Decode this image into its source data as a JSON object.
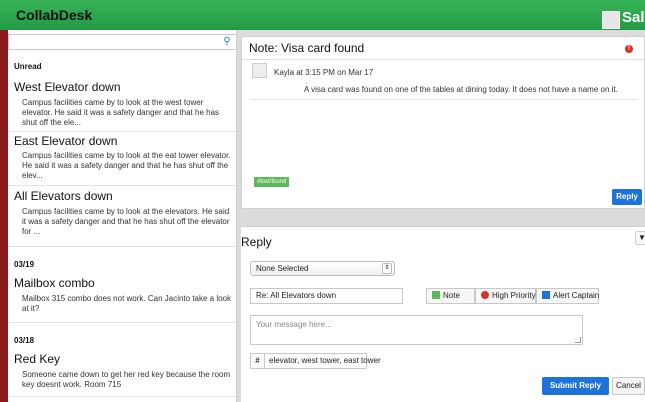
{
  "app": {
    "title": "CollabDesk",
    "user": "Sally"
  },
  "sidebar": {
    "search_placeholder": "",
    "groups": [
      {
        "label": "Unread"
      },
      {
        "label": "03/19"
      },
      {
        "label": "03/18"
      }
    ],
    "messages": [
      {
        "title": "West Elevator down",
        "body": "Campus facilities came by to look at the west tower elevator. He said it was a safety danger and that he has shut off the ele..."
      },
      {
        "title": "East Elevator down",
        "body": "Campus facilities came by to look at the eat tower elevator. He said it was a safety danger and that he has shut off the elev..."
      },
      {
        "title": "All Elevators down",
        "body": "Campus facilities came by to look at the elevators. He said it was a safety danger and that he has shut off the elevator for ..."
      },
      {
        "title": "Mailbox combo",
        "body": "Mailbox 315 combo does not work. Can Jacinto take a look at it?"
      },
      {
        "title": "Red Key",
        "body": "Someone came down to get her red key because the room key doesnt work. Room 715"
      }
    ]
  },
  "note": {
    "title": "Note: Visa card found",
    "author_line": "Kayla at 3:15 PM on Mar 17",
    "text": "A visa card was found on one of the tables at dining today. It does not have a name on it.",
    "tag": "#lost/found",
    "alert_symbol": "!",
    "reply_label": "Reply"
  },
  "reply": {
    "title": "Reply",
    "select_value": "None Selected",
    "subject_value": "Re: All Elevators down",
    "options": [
      {
        "label": "Note",
        "color": "#5cb85c"
      },
      {
        "label": "High Priority",
        "color": "#d9312b"
      },
      {
        "label": "Alert Captain",
        "color": "#1e73d8"
      }
    ],
    "message_placeholder": "Your message here...",
    "tags_value": "elevator, west tower, east tower",
    "submit_label": "Submit Reply",
    "cancel_label": "Cancel"
  },
  "icons": {
    "search": "search-icon",
    "alert": "alert-icon",
    "caret": "chevron-down-icon",
    "hash": "hash-icon"
  }
}
